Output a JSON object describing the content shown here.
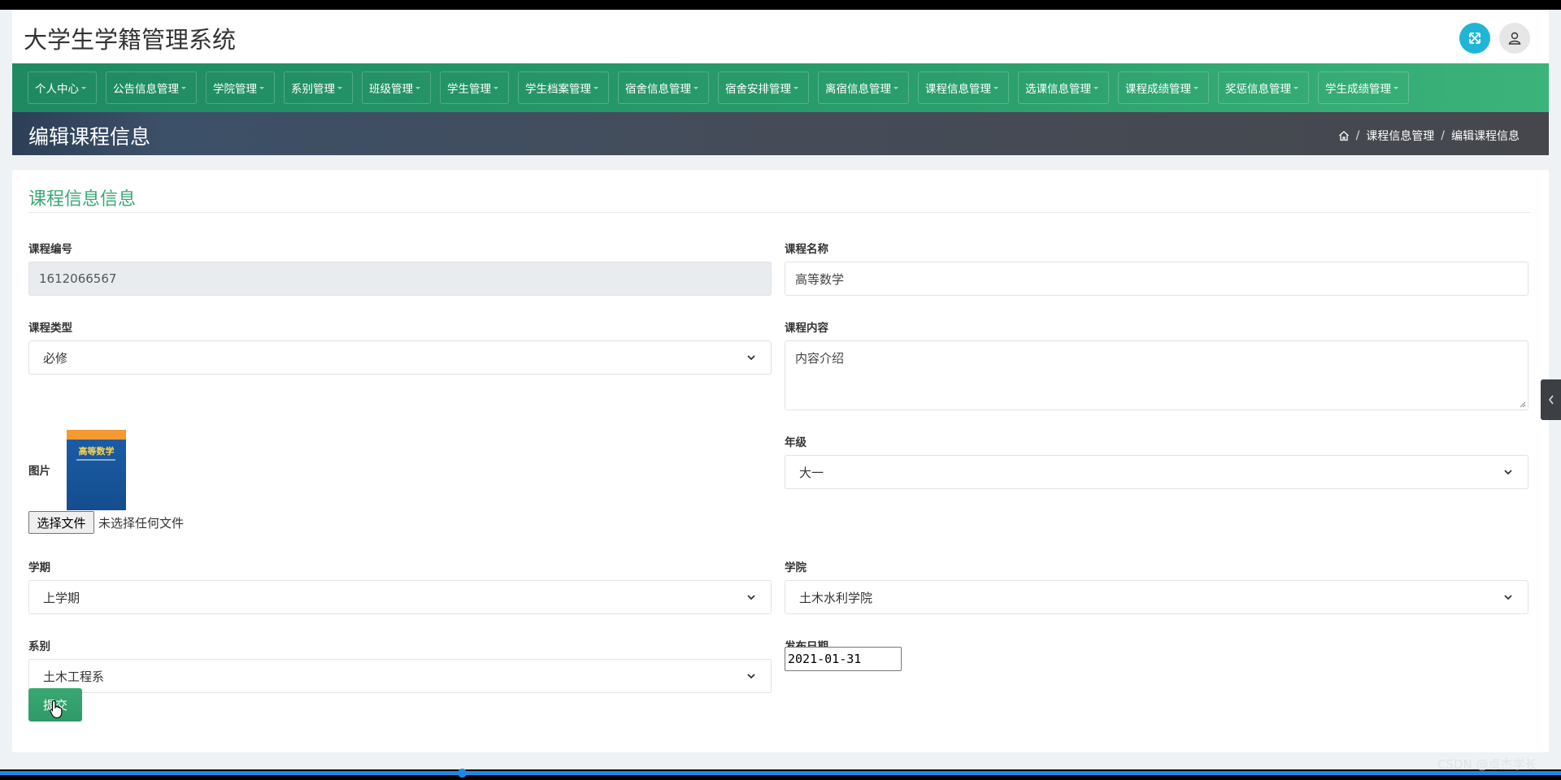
{
  "app": {
    "title": "大学生学籍管理系统"
  },
  "nav": {
    "items": [
      "个人中心",
      "公告信息管理",
      "学院管理",
      "系别管理",
      "班级管理",
      "学生管理",
      "学生档案管理",
      "宿舍信息管理",
      "宿舍安排管理",
      "离宿信息管理",
      "课程信息管理",
      "选课信息管理",
      "课程成绩管理",
      "奖惩信息管理",
      "学生成绩管理"
    ]
  },
  "page": {
    "title": "编辑课程信息",
    "breadcrumb": [
      "课程信息管理",
      "编辑课程信息"
    ]
  },
  "form": {
    "title": "课程信息信息",
    "course_no": {
      "label": "课程编号",
      "value": "1612066567"
    },
    "course_name": {
      "label": "课程名称",
      "value": "高等数学"
    },
    "course_type": {
      "label": "课程类型",
      "value": "必修"
    },
    "course_content": {
      "label": "课程内容",
      "value": "内容介绍"
    },
    "image": {
      "label": "图片",
      "cover_title": "高等数学",
      "file_button": "选择文件",
      "file_status": "未选择任何文件"
    },
    "grade": {
      "label": "年级",
      "value": "大一"
    },
    "term": {
      "label": "学期",
      "value": "上学期"
    },
    "college": {
      "label": "学院",
      "value": "土木水利学院"
    },
    "department": {
      "label": "系别",
      "value": "土木工程系"
    },
    "publish_date": {
      "label": "发布日期",
      "value": "2021-01-31"
    },
    "submit_label": "提交"
  },
  "watermark": "CSDN @卓杰学长",
  "icons": [
    "fullscreen-icon",
    "user-icon",
    "home-icon",
    "chevron-down-icon",
    "chevron-left-icon",
    "pointer-cursor-icon"
  ],
  "colors": {
    "accent": "#3aa873",
    "nav_bg": "#2a9e6c",
    "fullscreen_btn": "#1fb5d6"
  }
}
